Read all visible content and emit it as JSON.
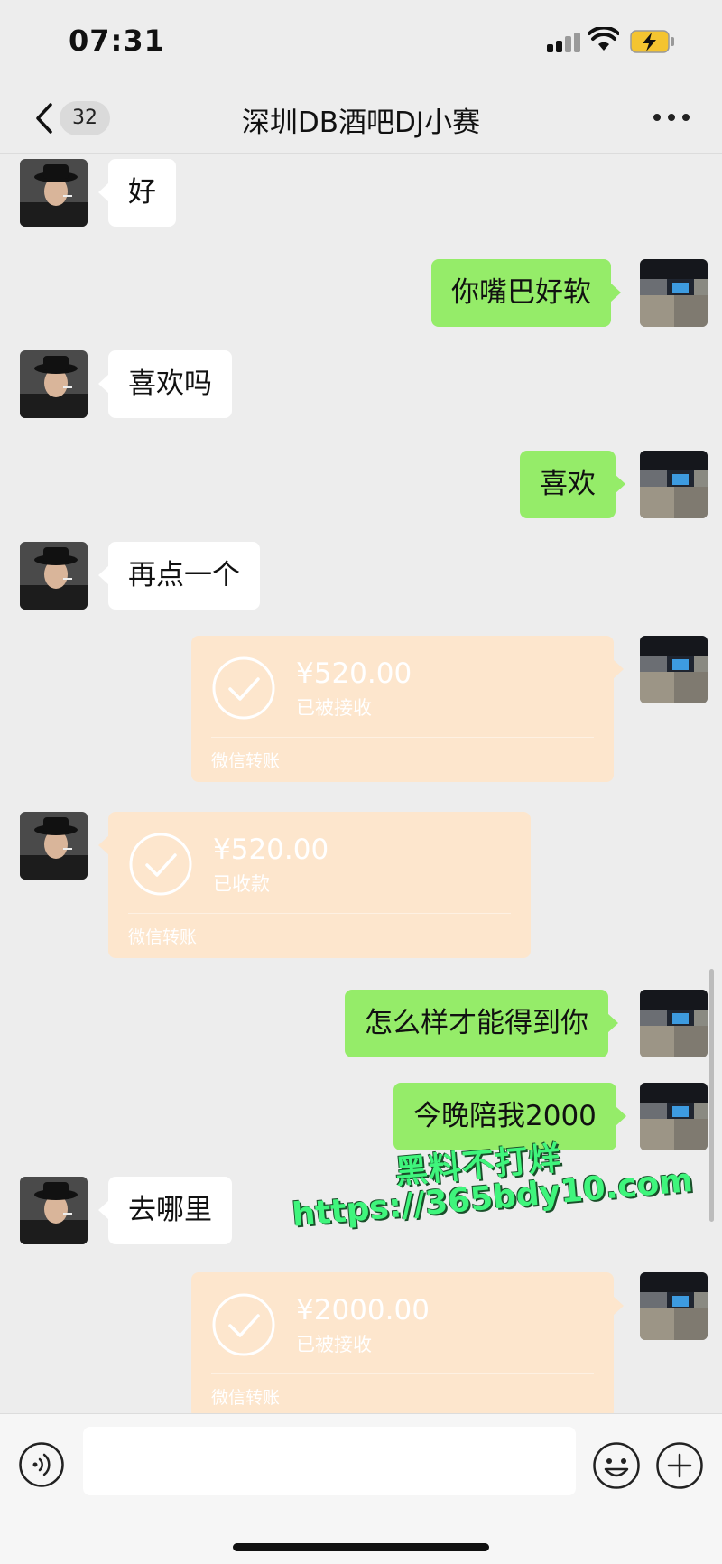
{
  "status_bar": {
    "time": "07:31"
  },
  "header": {
    "back_badge": "32",
    "title": "深圳DB酒吧DJ小赛"
  },
  "messages": [
    {
      "side": "left",
      "type": "text",
      "text": "好"
    },
    {
      "side": "right",
      "type": "text",
      "text": "你嘴巴好软"
    },
    {
      "side": "left",
      "type": "text",
      "text": "喜欢吗"
    },
    {
      "side": "right",
      "type": "text",
      "text": "喜欢"
    },
    {
      "side": "left",
      "type": "text",
      "text": "再点一个"
    },
    {
      "side": "right",
      "type": "transfer",
      "amount": "¥520.00",
      "status": "已被接收",
      "label": "微信转账"
    },
    {
      "side": "left",
      "type": "transfer",
      "amount": "¥520.00",
      "status": "已收款",
      "label": "微信转账"
    },
    {
      "side": "right",
      "type": "text",
      "text": "怎么样才能得到你"
    },
    {
      "side": "right",
      "type": "text",
      "text": "今晚陪我2000"
    },
    {
      "side": "left",
      "type": "text",
      "text": "去哪里"
    },
    {
      "side": "right",
      "type": "transfer",
      "amount": "¥2000.00",
      "status": "已被接收",
      "label": "微信转账"
    }
  ],
  "watermark": {
    "line1": "黑料不打烊",
    "line2": "https://365bdy10.com"
  },
  "input": {
    "value": ""
  },
  "icons": {
    "back": "chevron-left-icon",
    "more": "more-dots-icon",
    "voice": "voice-icon",
    "emoji": "emoji-icon",
    "plus": "plus-icon",
    "transfer": "checkmark-circle-icon"
  },
  "colors": {
    "background": "#ededed",
    "self_bubble": "#95ec69",
    "other_bubble": "#ffffff",
    "transfer_bubble": "#fde6cd",
    "watermark": "#3ff57c"
  }
}
